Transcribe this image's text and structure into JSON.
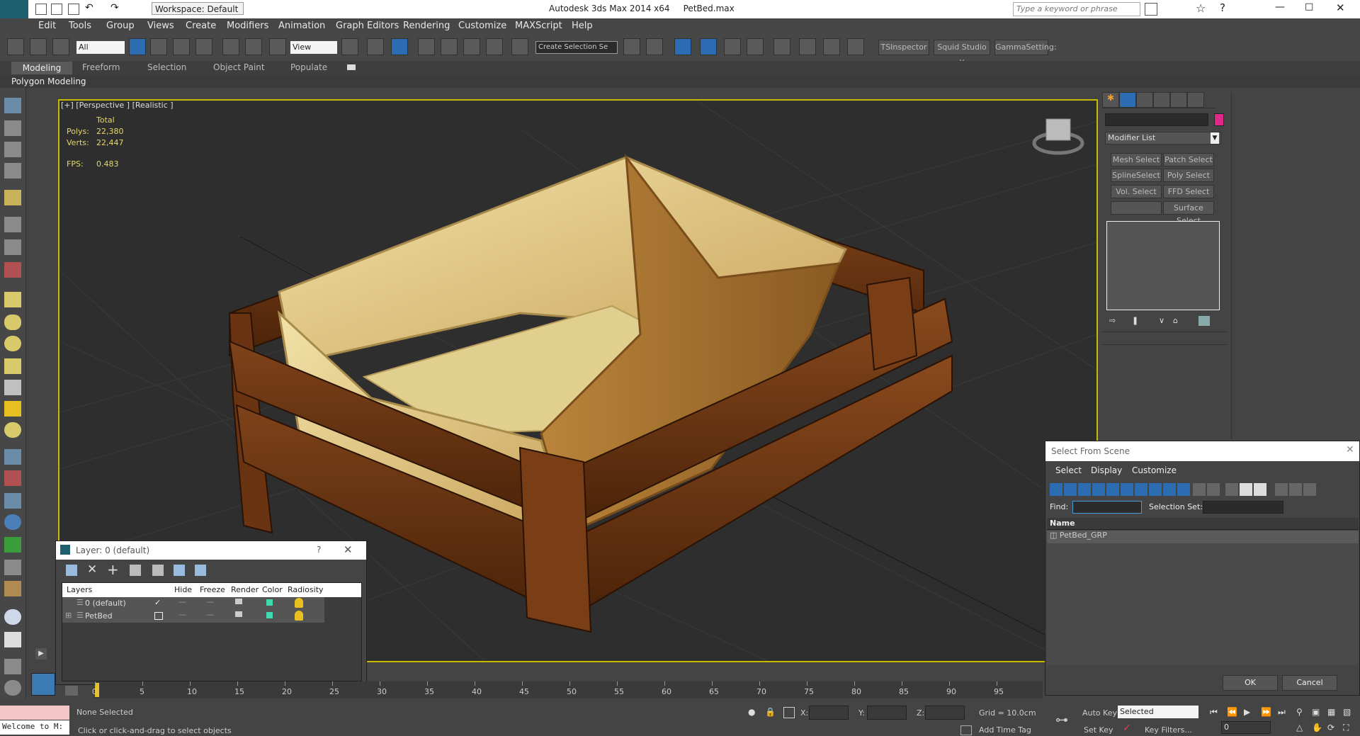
{
  "titlebar": {
    "workspace": "Workspace: Default",
    "app_title": "Autodesk 3ds Max  2014 x64",
    "file_name": "PetBed.max",
    "search_placeholder": "Type a keyword or phrase"
  },
  "menu": [
    "Edit",
    "Tools",
    "Group",
    "Views",
    "Create",
    "Modifiers",
    "Animation",
    "Graph Editors",
    "Rendering",
    "Customize",
    "MAXScript",
    "Help"
  ],
  "toolbar": {
    "filter": "All",
    "ref_coord": "View",
    "selection_set_placeholder": "Create Selection Se",
    "plugins": [
      "TSInspector",
      "Squid Studio v",
      "GammaSetting:"
    ]
  },
  "ribbon": {
    "tabs": [
      "Modeling",
      "Freeform",
      "Selection",
      "Object Paint",
      "Populate"
    ],
    "sub_tab": "Polygon Modeling"
  },
  "viewport": {
    "label": "[+] [Perspective ] [Realistic ]",
    "stats_header": "Total",
    "polys_label": "Polys:",
    "polys_value": "22,380",
    "verts_label": "Verts:",
    "verts_value": "22,447",
    "fps_label": "FPS:",
    "fps_value": "0.483"
  },
  "command_panel": {
    "modifier_list": "Modifier List",
    "buttons": [
      "Mesh Select",
      "Patch Select",
      "SplineSelect",
      "Poly Select",
      "Vol. Select",
      "FFD Select",
      "",
      "Surface Select"
    ],
    "object_color": "#e0288a"
  },
  "layer_dialog": {
    "title": "Layer: 0 (default)",
    "help": "?",
    "columns": [
      "Layers",
      "Hide",
      "Freeze",
      "Render",
      "Color",
      "Radiosity"
    ],
    "rows": [
      {
        "name": "0 (default)"
      },
      {
        "name": "PetBed"
      }
    ]
  },
  "select_dialog": {
    "title": "Select From Scene",
    "menu": [
      "Select",
      "Display",
      "Customize"
    ],
    "find_label": "Find:",
    "selection_set_label": "Selection Set:",
    "column": "Name",
    "items": [
      "PetBed_GRP"
    ],
    "ok": "OK",
    "cancel": "Cancel"
  },
  "timeline": {
    "ticks": [
      "0",
      "5",
      "10",
      "15",
      "20",
      "25",
      "30",
      "35",
      "40",
      "45",
      "50",
      "55",
      "60",
      "65",
      "70",
      "75",
      "80",
      "85",
      "90",
      "95"
    ]
  },
  "status": {
    "listener": "Welcome to M:",
    "selection": "None Selected",
    "prompt": "Click or click-and-drag to select objects",
    "x_label": "X:",
    "y_label": "Y:",
    "z_label": "Z:",
    "grid": "Grid = 10.0cm",
    "add_time_tag": "Add Time Tag",
    "auto_key": "Auto Key",
    "set_key": "Set Key",
    "key_mode": "Selected",
    "key_filters": "Key Filters...",
    "frame": "0"
  }
}
